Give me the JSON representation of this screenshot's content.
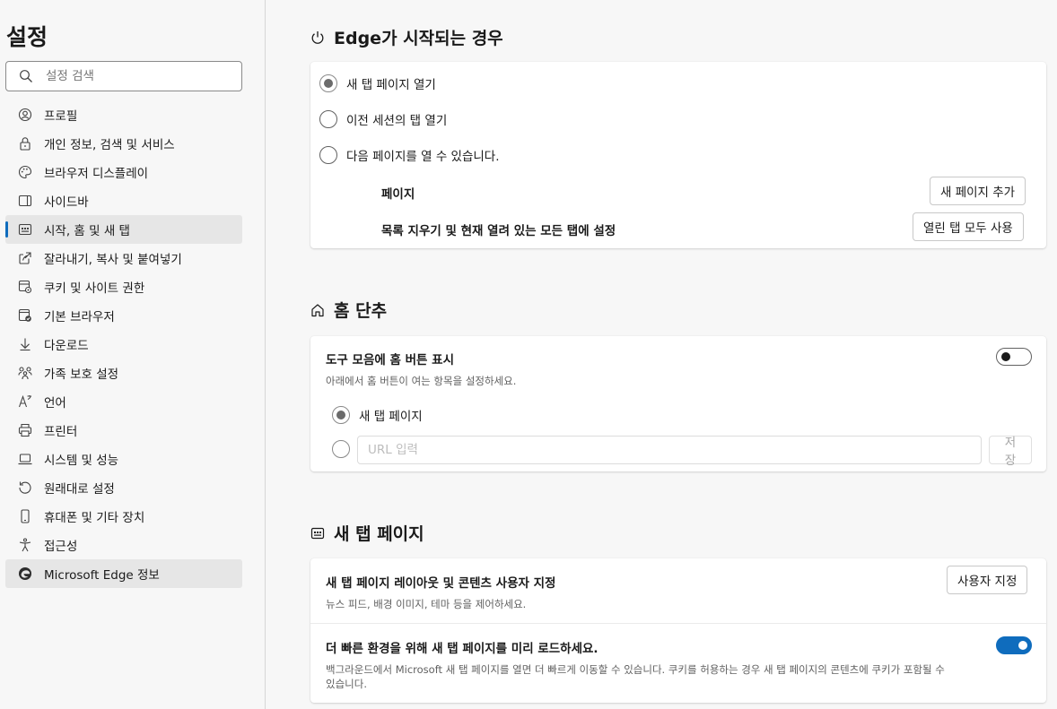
{
  "sidebar": {
    "title": "설정",
    "search_placeholder": "설정 검색",
    "items": [
      {
        "label": "프로필",
        "icon": "profile-icon"
      },
      {
        "label": "개인 정보, 검색 및 서비스",
        "icon": "lock-icon"
      },
      {
        "label": "브라우저 디스플레이",
        "icon": "palette-icon"
      },
      {
        "label": "사이드바",
        "icon": "sidebar-icon"
      },
      {
        "label": "시작, 홈 및 새 탭",
        "icon": "start-home-icon",
        "active": true
      },
      {
        "label": "잘라내기, 복사 및 붙여넣기",
        "icon": "share-icon"
      },
      {
        "label": "쿠키 및 사이트 권한",
        "icon": "cookie-permissions-icon"
      },
      {
        "label": "기본 브라우저",
        "icon": "default-browser-icon"
      },
      {
        "label": "다운로드",
        "icon": "download-icon"
      },
      {
        "label": "가족 보호 설정",
        "icon": "family-icon"
      },
      {
        "label": "언어",
        "icon": "language-icon"
      },
      {
        "label": "프린터",
        "icon": "printer-icon"
      },
      {
        "label": "시스템 및 성능",
        "icon": "laptop-icon"
      },
      {
        "label": "원래대로 설정",
        "icon": "reset-icon"
      },
      {
        "label": "휴대폰 및 기타 장치",
        "icon": "phone-icon"
      },
      {
        "label": "접근성",
        "icon": "accessibility-icon"
      },
      {
        "label": "Microsoft Edge 정보",
        "icon": "edge-logo-icon"
      }
    ]
  },
  "startup": {
    "title": "Edge가 시작되는 경우",
    "options": [
      "새 탭 페이지 열기",
      "이전 세션의 탭 열기",
      "다음 페이지를 열 수 있습니다."
    ],
    "selected_index": 0,
    "pages_label": "페이지",
    "add_page_button": "새 페이지 추가",
    "clear_label": "목록 지우기 및 현재 열려 있는 모든 탭에 설정",
    "use_open_tabs_button": "열린 탭 모두 사용"
  },
  "home": {
    "title": "홈 단추",
    "show_home_label": "도구 모음에 홈 버튼 표시",
    "show_home_enabled": false,
    "show_home_description": "아래에서 홈 버튼이 여는 항목을 설정하세요.",
    "new_tab_option": "새 탭 페이지",
    "url_placeholder": "URL 입력",
    "save_button": "저장"
  },
  "new_tab": {
    "title": "새 탭 페이지",
    "customize_label": "새 탭 페이지 레이아웃 및 콘텐츠 사용자 지정",
    "customize_description": "뉴스 피드, 배경 이미지, 테마 등을 제어하세요.",
    "customize_button": "사용자 지정",
    "preload_label": "더 빠른 환경을 위해 새 탭 페이지를 미리 로드하세요.",
    "preload_enabled": true,
    "preload_description_line1": "백그라운드에서 Microsoft 새 탭 페이지를 열면 더 빠르게 이동할 수 있습니다. 쿠키를 허용하는 경우 새 탭 페이지의 콘텐츠에 쿠키가 포함될 수",
    "preload_description_line2": "있습니다."
  },
  "colors": {
    "accent": "#0f6cbd",
    "active_nav_bg": "#e6e6e6",
    "page_bg": "#f7f7f7"
  }
}
